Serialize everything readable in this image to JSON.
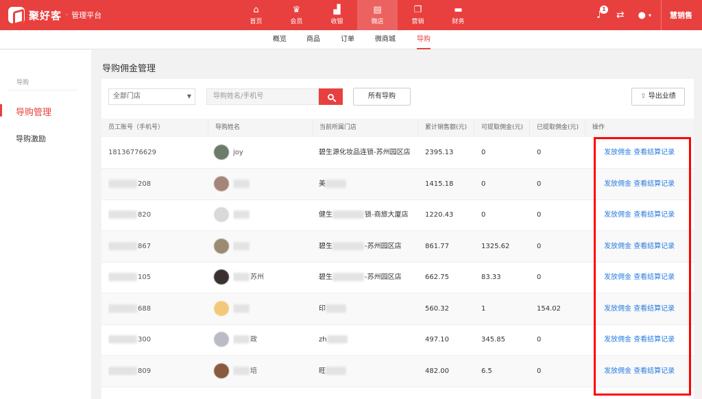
{
  "brand": {
    "name": "聚好客",
    "separator": "·",
    "subtitle": "管理平台"
  },
  "topnav": [
    {
      "label": "首页",
      "icon": "home-icon",
      "glyph": "⌂",
      "active": false
    },
    {
      "label": "会员",
      "icon": "crown-icon",
      "glyph": "♛",
      "active": false
    },
    {
      "label": "收银",
      "icon": "cashier-icon",
      "glyph": "▟",
      "active": false
    },
    {
      "label": "微店",
      "icon": "store-icon",
      "glyph": "▤",
      "active": true
    },
    {
      "label": "营销",
      "icon": "box-icon",
      "glyph": "❒",
      "active": false
    },
    {
      "label": "财务",
      "icon": "wallet-icon",
      "glyph": "▬",
      "active": false
    }
  ],
  "topright": {
    "notification_count": "1",
    "store_name": "慧销售"
  },
  "subnav": [
    {
      "label": "概览",
      "active": false
    },
    {
      "label": "商品",
      "active": false
    },
    {
      "label": "订单",
      "active": false
    },
    {
      "label": "微商城",
      "active": false
    },
    {
      "label": "导购",
      "active": true
    }
  ],
  "sidebar": {
    "group": "导购",
    "items": [
      {
        "label": "导购管理",
        "active": true
      },
      {
        "label": "导购激励",
        "active": false
      }
    ]
  },
  "page_title": "导购佣金管理",
  "filters": {
    "store_select": "全部门店",
    "search_placeholder": "导购姓名/手机号",
    "all_guides_button": "所有导购",
    "export_button": "导出业绩"
  },
  "table": {
    "headers": [
      "员工账号（手机号）",
      "导购姓名",
      "当前所属门店",
      "累计销售额(元)",
      "可提取佣金(元)",
      "已提取佣金(元)",
      "操作"
    ],
    "action_pay": "发放佣金",
    "action_records": "查看结算记录",
    "rows": [
      {
        "account_suffix": "18136776629",
        "name_suffix": "joy",
        "store_prefix": "碧生",
        "store_suffix": "源化妆品连锁-苏州园区店",
        "sales": "2395.13",
        "withdrawable": "0",
        "withdrawn": "0",
        "avatar_color": "#6b7c6a"
      },
      {
        "account_suffix": "208",
        "name_suffix": "",
        "store_prefix": "美",
        "store_suffix": "",
        "sales": "1415.18",
        "withdrawable": "0",
        "withdrawn": "0",
        "avatar_color": "#a58577"
      },
      {
        "account_suffix": "820",
        "name_suffix": "",
        "store_prefix": "健生",
        "store_suffix": "锁-商旅大厦店",
        "sales": "1220.43",
        "withdrawable": "0",
        "withdrawn": "0",
        "avatar_color": "#d9d9d9"
      },
      {
        "account_suffix": "867",
        "name_suffix": "",
        "store_prefix": "碧生",
        "store_suffix": "-苏州园区店",
        "sales": "861.77",
        "withdrawable": "1325.62",
        "withdrawn": "0",
        "avatar_color": "#9c8a73"
      },
      {
        "account_suffix": "105",
        "name_suffix": "苏州",
        "store_prefix": "碧生",
        "store_suffix": "-苏州园区店",
        "sales": "662.75",
        "withdrawable": "83.33",
        "withdrawn": "0",
        "avatar_color": "#3a3030"
      },
      {
        "account_suffix": "688",
        "name_suffix": "",
        "store_prefix": "印",
        "store_suffix": "",
        "sales": "560.32",
        "withdrawable": "1",
        "withdrawn": "154.02",
        "avatar_color": "#f2c97a"
      },
      {
        "account_suffix": "300",
        "name_suffix": "政",
        "store_prefix": "zh",
        "store_suffix": "",
        "sales": "497.10",
        "withdrawable": "345.85",
        "withdrawn": "0",
        "avatar_color": "#b9bcc4"
      },
      {
        "account_suffix": "809",
        "name_suffix": "培",
        "store_prefix": "旺",
        "store_suffix": "",
        "sales": "482.00",
        "withdrawable": "6.5",
        "withdrawn": "0",
        "avatar_color": "#8a5a3e"
      }
    ]
  },
  "colors": {
    "brand_red": "#e8403f",
    "link_blue": "#2a7de1",
    "highlight_red": "#ff0000"
  }
}
